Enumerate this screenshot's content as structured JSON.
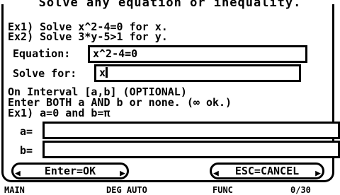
{
  "title": "Solve any equation or inequality.",
  "instructions": {
    "ex1": "Ex1) Solve x^2-4=0 for x.",
    "ex2": "Ex2) Solve 3*y-5>1 for y."
  },
  "equation": {
    "label": "Equation:",
    "value": "x^2-4=0"
  },
  "solve_for": {
    "label": "Solve for:",
    "value": "x"
  },
  "interval": {
    "line1": "On Interval [a,b] (OPTIONAL)",
    "line2": "Enter BOTH a AND b or none. (∞ ok.)",
    "line3": "Ex1) a=0 and b=π"
  },
  "a_field": {
    "label": "a=",
    "value": ""
  },
  "b_field": {
    "label": "b=",
    "value": ""
  },
  "buttons": {
    "ok": "Enter=OK",
    "cancel": "ESC=CANCEL"
  },
  "statusbar": {
    "left": "MAIN",
    "mid": "DEG AUTO",
    "mid2": "FUNC",
    "right": "0/30"
  }
}
